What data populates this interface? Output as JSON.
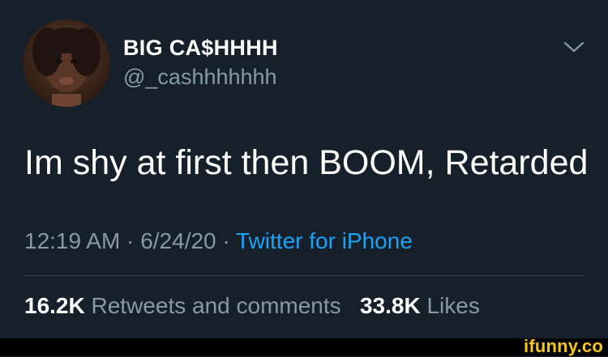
{
  "tweet": {
    "display_name": "BIG CA$HHHH",
    "handle": "@_cashhhhhhh",
    "text": "Im shy at first then BOOM, Retarded",
    "time": "12:19 AM",
    "date": "6/24/20",
    "separator": "·",
    "source": "Twitter for iPhone",
    "retweets_count": "16.2K",
    "retweets_label": "Retweets and comments",
    "likes_count": "33.8K",
    "likes_label": "Likes",
    "menu_icon": "chevron-down-icon"
  },
  "watermark": {
    "text": "ifunny.co"
  },
  "colors": {
    "background": "#15202b",
    "text": "#ffffff",
    "secondary_text": "#8899a6",
    "link": "#1da1f2",
    "divider": "#38444d",
    "watermark": "#f5c518"
  }
}
